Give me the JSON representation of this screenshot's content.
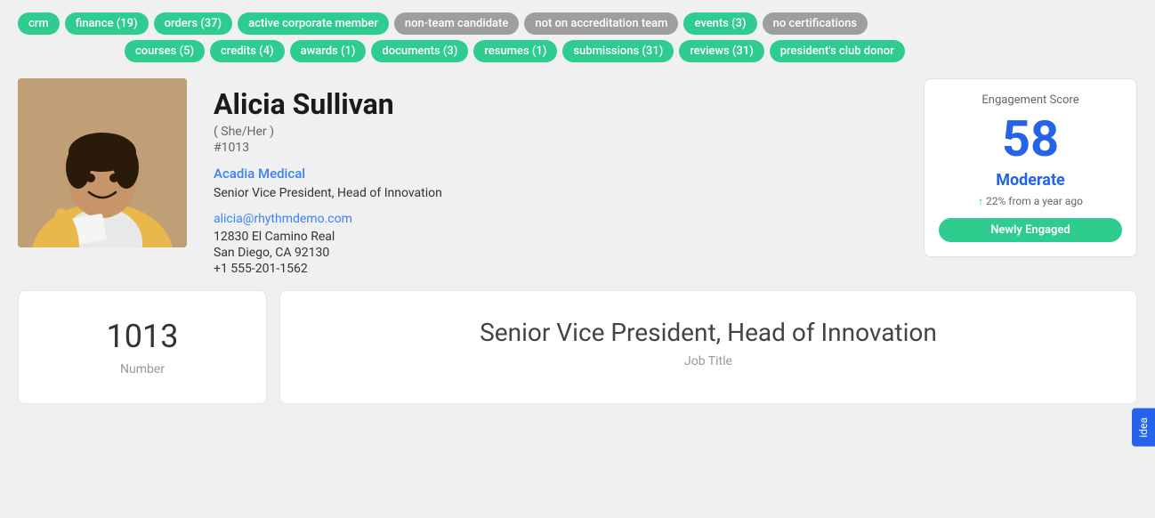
{
  "tags": [
    {
      "label": "crm",
      "style": "green"
    },
    {
      "label": "finance (19)",
      "style": "green"
    },
    {
      "label": "orders (37)",
      "style": "green"
    },
    {
      "label": "active corporate member",
      "style": "green"
    },
    {
      "label": "non-team candidate",
      "style": "gray"
    },
    {
      "label": "not on accreditation team",
      "style": "gray"
    },
    {
      "label": "events (3)",
      "style": "green"
    },
    {
      "label": "no certifications",
      "style": "gray"
    },
    {
      "label": "courses (5)",
      "style": "green"
    },
    {
      "label": "credits (4)",
      "style": "green"
    },
    {
      "label": "awards (1)",
      "style": "green"
    },
    {
      "label": "documents (3)",
      "style": "green"
    },
    {
      "label": "resumes (1)",
      "style": "green"
    },
    {
      "label": "submissions (31)",
      "style": "green"
    },
    {
      "label": "reviews (31)",
      "style": "green"
    },
    {
      "label": "president's club donor",
      "style": "green"
    }
  ],
  "profile": {
    "name": "Alicia Sullivan",
    "pronouns": "( She/Her )",
    "id": "#1013",
    "company": "Acadia Medical",
    "title": "Senior Vice President, Head of Innovation",
    "email": "alicia@rhythmdemo.com",
    "address1": "12830 El Camino Real",
    "address2": "San Diego, CA 92130",
    "phone": "+1 555-201-1562"
  },
  "engagement": {
    "title": "Engagement Score",
    "score": "58",
    "level": "Moderate",
    "change": "22% from a year ago",
    "badge": "Newly Engaged"
  },
  "stats": [
    {
      "value": "1013",
      "label": "Number"
    },
    {
      "value": "Senior Vice President, Head of Innovation",
      "label": "Job Title"
    }
  ],
  "idea_tab": "idea"
}
